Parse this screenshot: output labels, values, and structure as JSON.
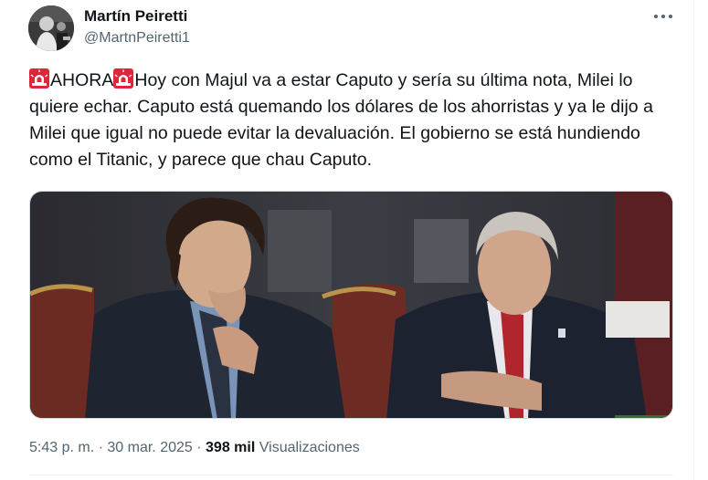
{
  "author": {
    "name": "Martín Peiretti",
    "handle": "@MartnPeiretti1",
    "avatar_icon": "profile-photo"
  },
  "tweet": {
    "badge_icon": "police-light-emoji",
    "badge_text": "AHORA",
    "body": "Hoy con Majul va a estar Caputo y sería su última nota, Milei lo quiere echar. Caputo está quemando los dólares de los ahorristas y ya le dijo a Milei que igual no puede evitar la devaluación. El gobierno se está hundiendo como el Titanic, y parece que chau Caputo.",
    "media_icon": "photo-two-men-seated"
  },
  "meta": {
    "time": "5:43 p. m.",
    "separator": "·",
    "date": "30 mar. 2025",
    "views_count": "398 mil",
    "views_label": "Visualizaciones"
  },
  "colors": {
    "text_primary": "#0f1419",
    "text_secondary": "#536471",
    "border": "#cfd9de",
    "siren_red": "#e0243a"
  }
}
